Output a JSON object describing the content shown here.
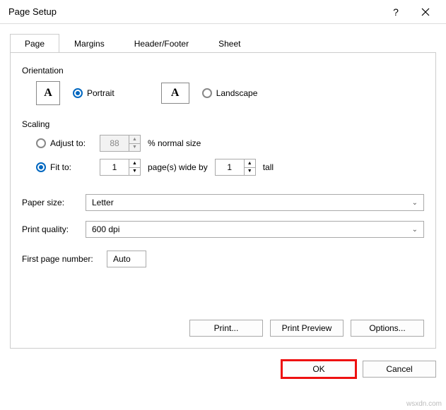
{
  "window": {
    "title": "Page Setup"
  },
  "tabs": {
    "page": "Page",
    "margins": "Margins",
    "headerfooter": "Header/Footer",
    "sheet": "Sheet"
  },
  "orientation": {
    "label": "Orientation",
    "portrait": "Portrait",
    "landscape": "Landscape",
    "iconA": "A"
  },
  "scaling": {
    "label": "Scaling",
    "adjust_to": "Adjust to:",
    "adjust_value": "88",
    "adjust_suffix": "% normal size",
    "fit_to": "Fit to:",
    "fit_wide": "1",
    "fit_mid": "page(s) wide by",
    "fit_tall": "1",
    "fit_suffix": "tall"
  },
  "paper": {
    "size_label": "Paper size:",
    "size_value": "Letter",
    "quality_label": "Print quality:",
    "quality_value": "600 dpi"
  },
  "firstpage": {
    "label": "First page number:",
    "value": "Auto"
  },
  "buttons": {
    "print": "Print...",
    "preview": "Print Preview",
    "options": "Options...",
    "ok": "OK",
    "cancel": "Cancel"
  },
  "watermark": "wsxdn.com"
}
